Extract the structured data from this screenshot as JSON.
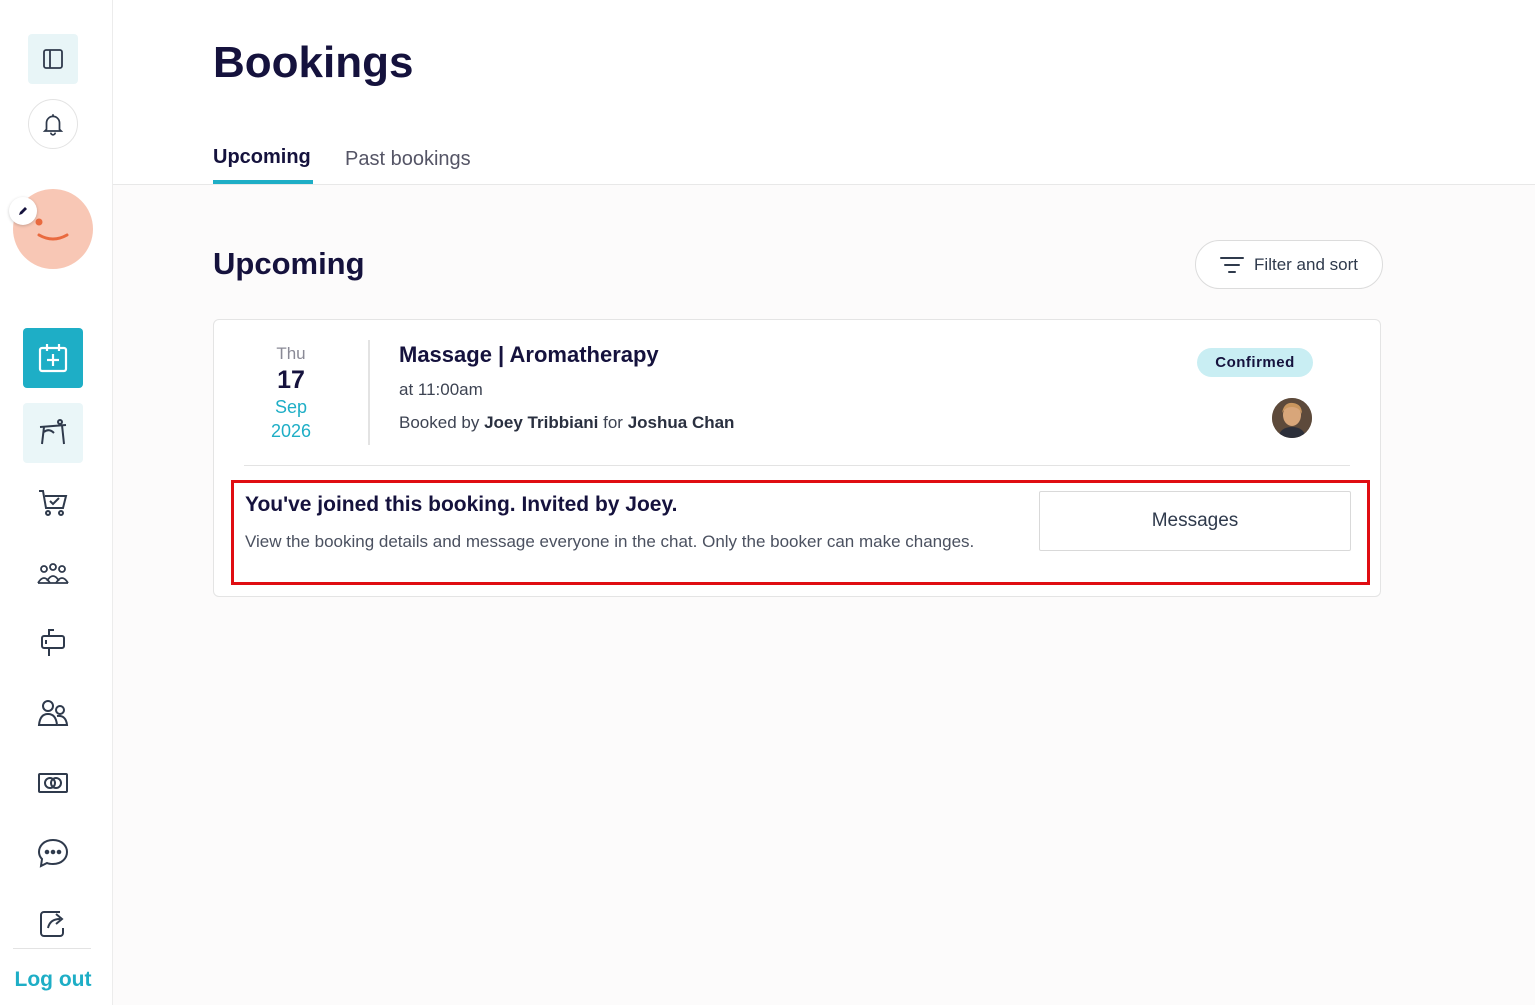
{
  "sidebar": {
    "logout_label": "Log out",
    "items": [
      {
        "icon": "calendar-plus-icon",
        "state": "active"
      },
      {
        "icon": "massage-table-icon",
        "state": "soft"
      },
      {
        "icon": "cart-check-icon",
        "state": "normal"
      },
      {
        "icon": "group-icon",
        "state": "normal"
      },
      {
        "icon": "mailbox-icon",
        "state": "normal"
      },
      {
        "icon": "people-icon",
        "state": "normal"
      },
      {
        "icon": "money-icon",
        "state": "normal"
      },
      {
        "icon": "chat-icon",
        "state": "normal"
      },
      {
        "icon": "share-icon",
        "state": "normal"
      }
    ]
  },
  "header": {
    "title": "Bookings",
    "tabs": [
      {
        "label": "Upcoming",
        "active": true
      },
      {
        "label": "Past bookings",
        "active": false
      }
    ]
  },
  "section": {
    "title": "Upcoming",
    "filter_label": "Filter and sort"
  },
  "booking": {
    "date": {
      "dow": "Thu",
      "day": "17",
      "month": "Sep",
      "year": "2026"
    },
    "service": "Massage | Aromatherapy",
    "time": "at 11:00am",
    "booked_prefix": "Booked by",
    "booker": "Joey Tribbiani",
    "for_word": "for",
    "guest": "Joshua Chan",
    "status": "Confirmed"
  },
  "notice": {
    "title": "You've joined this booking. Invited by Joey.",
    "description": "View the booking details and message everyone in the chat. Only the booker can make changes.",
    "messages_label": "Messages"
  },
  "colors": {
    "accent": "#1eaec6",
    "navy": "#15123d",
    "highlight": "#e00d12",
    "badge_bg": "#c9eef3"
  }
}
